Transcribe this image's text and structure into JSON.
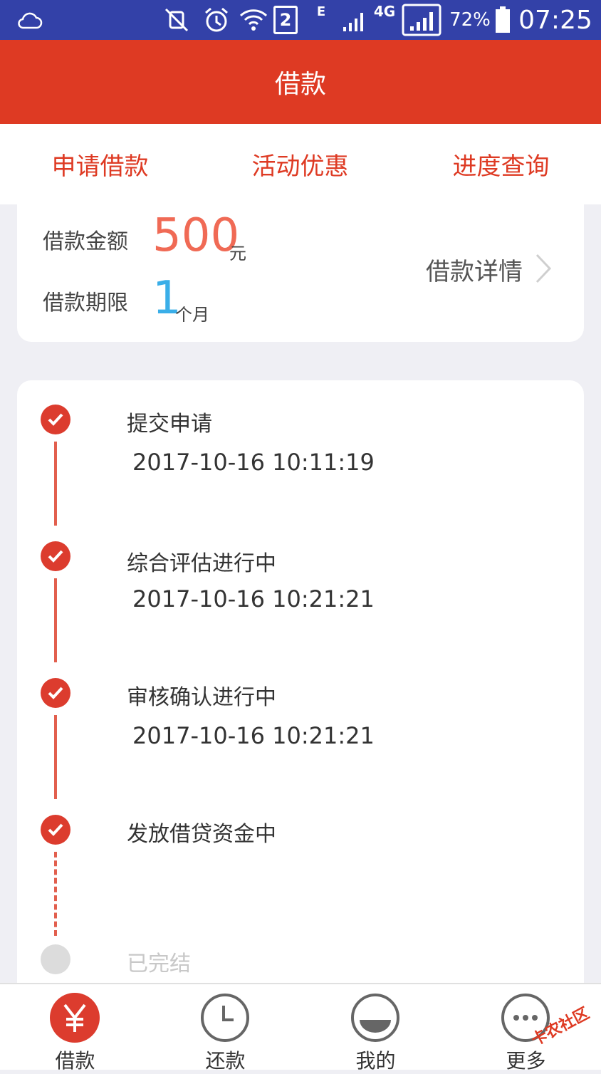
{
  "status_bar": {
    "sim_label": "2",
    "network_e": "E",
    "network_4g": "4G",
    "battery": "72%",
    "time": "07:25"
  },
  "header": {
    "title": "借款"
  },
  "tabs": [
    {
      "label": "申请借款",
      "active": false
    },
    {
      "label": "活动优惠",
      "active": false
    },
    {
      "label": "进度查询",
      "active": true
    }
  ],
  "summary": {
    "amount_label": "借款金额",
    "amount_value": "500",
    "amount_unit": "元",
    "term_label": "借款期限",
    "term_value": "1",
    "term_unit": "个月",
    "detail_link": "借款详情"
  },
  "timeline": [
    {
      "title": "提交申请",
      "time": "2017-10-16 10:11:19",
      "done": true
    },
    {
      "title": "综合评估进行中",
      "time": "2017-10-16 10:21:21",
      "done": true
    },
    {
      "title": "审核确认进行中",
      "time": "2017-10-16 10:21:21",
      "done": true
    },
    {
      "title": "发放借贷资金中",
      "time": "",
      "done": true
    },
    {
      "title": "已完结",
      "time": "",
      "done": false
    }
  ],
  "bottom_nav": [
    {
      "label": "借款",
      "icon": "yen-icon",
      "active": true
    },
    {
      "label": "还款",
      "icon": "clock-icon",
      "active": false
    },
    {
      "label": "我的",
      "icon": "user-icon",
      "active": false
    },
    {
      "label": "更多",
      "icon": "more-icon",
      "active": false
    }
  ],
  "watermark": "卡农社区",
  "colors": {
    "brand_red": "#de3a23",
    "status_blue": "#3341a8",
    "amount_orange": "#f06a55",
    "term_blue": "#3aaee8"
  }
}
